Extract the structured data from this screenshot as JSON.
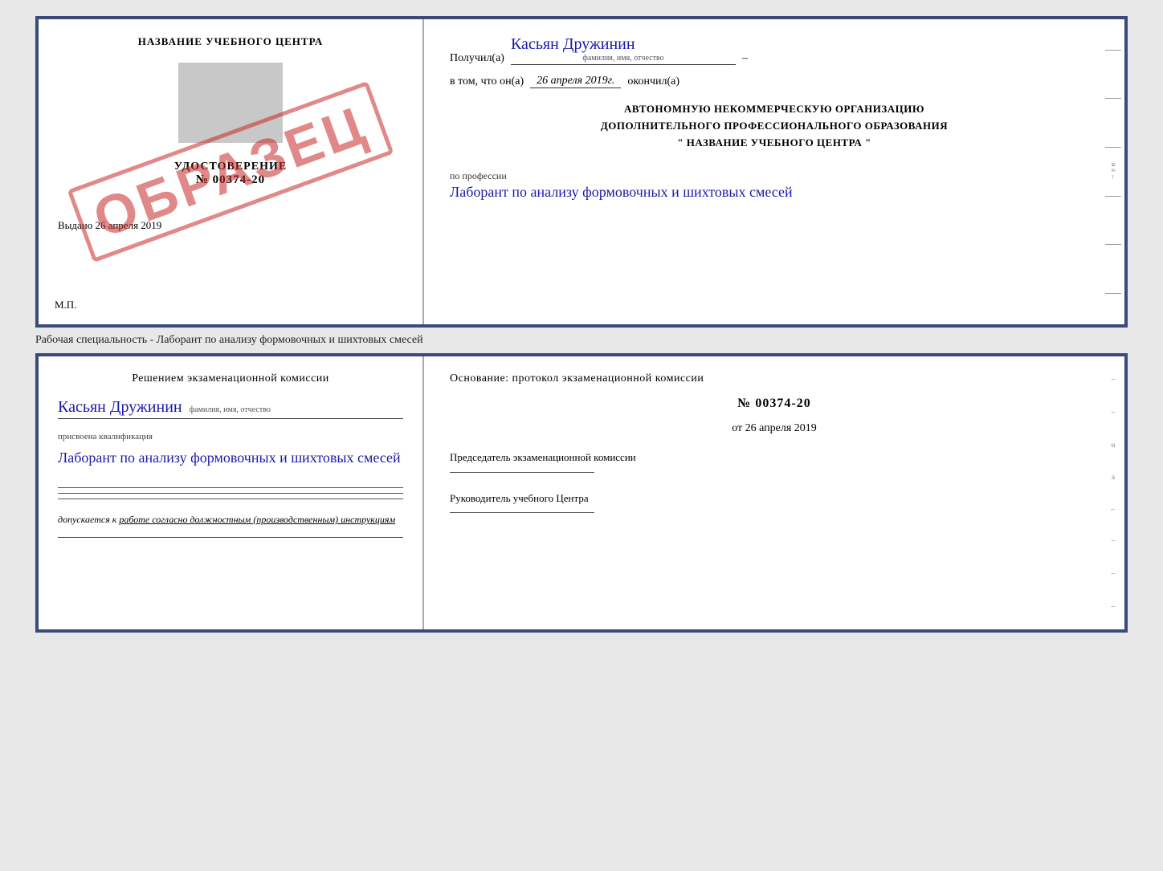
{
  "top_cert": {
    "left": {
      "title": "НАЗВАНИЕ УЧЕБНОГО ЦЕНТРА",
      "cert_label": "УДОСТОВЕРЕНИЕ",
      "cert_number_prefix": "№",
      "cert_number": "00374-20",
      "issued_label": "Выдано",
      "issued_date": "26 апреля 2019",
      "mp_label": "М.П.",
      "obrazec": "ОБРАЗЕЦ"
    },
    "right": {
      "received_label": "Получил(а)",
      "recipient_name": "Касьян Дружинин",
      "recipient_subtitle": "фамилия, имя, отчество",
      "date_prefix": "в том, что он(а)",
      "date_value": "26 апреля 2019г.",
      "date_suffix": "окончил(а)",
      "org_line1": "АВТОНОМНУЮ НЕКОММЕРЧЕСКУЮ ОРГАНИЗАЦИЮ",
      "org_line2": "ДОПОЛНИТЕЛЬНОГО ПРОФЕССИОНАЛЬНОГО ОБРАЗОВАНИЯ",
      "org_name": "\" НАЗВАНИЕ УЧЕБНОГО ЦЕНТРА \"",
      "profession_label": "по профессии",
      "profession_value": "Лаборант по анализу формовочных и шихтовых смесей"
    }
  },
  "specialty_text": "Рабочая специальность - Лаборант по анализу формовочных и шихтовых смесей",
  "bottom_cert": {
    "left": {
      "commission_title": "Решением экзаменационной комиссии",
      "person_name": "Касьян Дружинин",
      "person_subtitle": "фамилия, имя, отчество",
      "qualification_label": "присвоена квалификация",
      "qualification_value": "Лаборант по анализу формовочных и шихтовых смесей",
      "allow_prefix": "допускается к",
      "allow_text": "работе согласно должностным (производственным) инструкциям"
    },
    "right": {
      "basis_title": "Основание: протокол экзаменационной комиссии",
      "protocol_prefix": "№",
      "protocol_number": "00374-20",
      "date_prefix": "от",
      "date_value": "26 апреля 2019",
      "chairman_label": "Председатель экзаменационной комиссии",
      "director_label": "Руководитель учебного Центра"
    }
  }
}
